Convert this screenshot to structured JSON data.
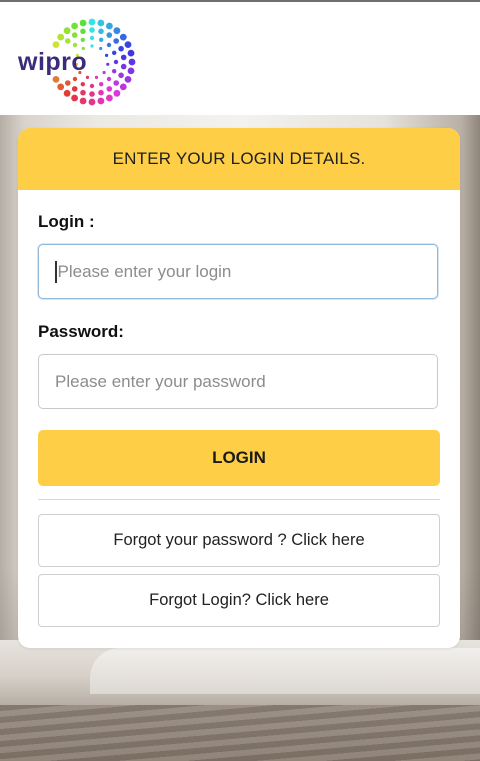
{
  "brand": {
    "name": "wipro"
  },
  "form": {
    "heading": "ENTER YOUR LOGIN DETAILS.",
    "login_label": "Login :",
    "login_value": "",
    "login_placeholder": "Please enter your login",
    "password_label": "Password:",
    "password_value": "",
    "password_placeholder": "Please enter your password",
    "submit_label": "LOGIN",
    "forgot_password_label": "Forgot your password ? Click here",
    "forgot_login_label": "Forgot Login? Click here"
  },
  "colors": {
    "accent": "#fece47",
    "logo_text": "#3b2b7a",
    "focus_border": "#90b8da"
  }
}
